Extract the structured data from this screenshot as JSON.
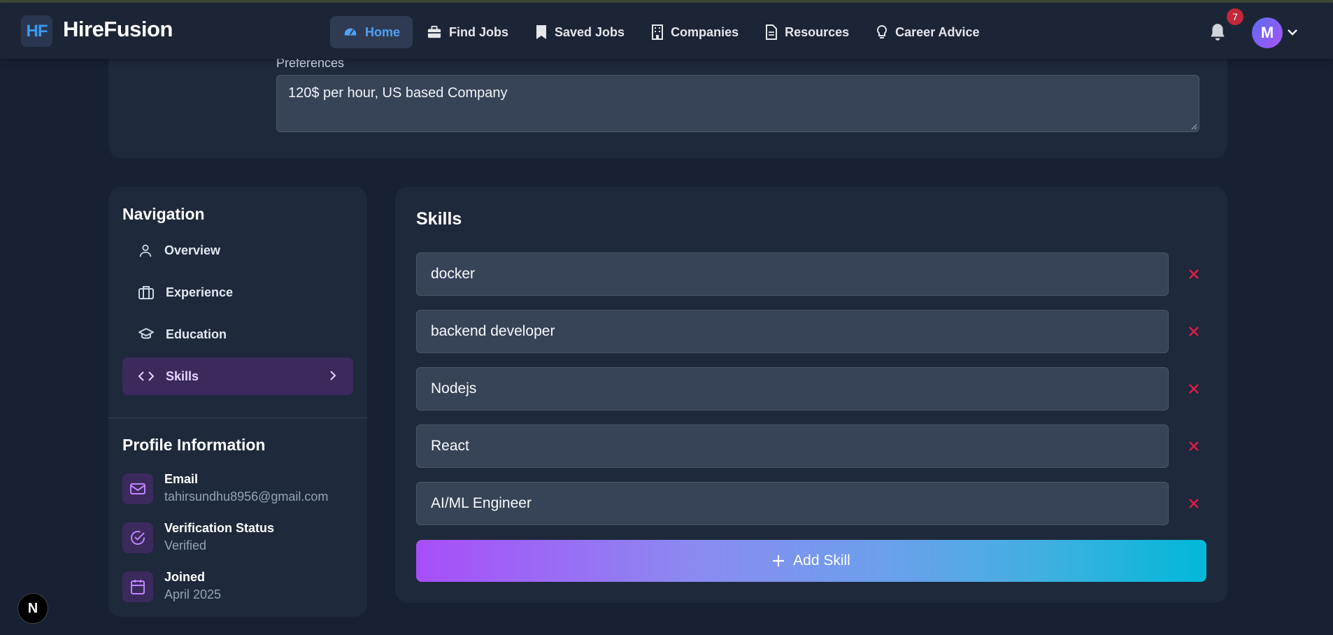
{
  "header": {
    "logo_mark": "HF",
    "app_name": "HireFusion",
    "nav": [
      {
        "label": "Home",
        "icon": "dashboard-icon",
        "active": true
      },
      {
        "label": "Find Jobs",
        "icon": "briefcase-icon"
      },
      {
        "label": "Saved Jobs",
        "icon": "bookmark-icon"
      },
      {
        "label": "Companies",
        "icon": "building-icon"
      },
      {
        "label": "Resources",
        "icon": "document-icon"
      },
      {
        "label": "Career Advice",
        "icon": "lightbulb-icon"
      }
    ],
    "notification_count": "7",
    "avatar_initial": "M"
  },
  "preferences": {
    "label": "Preferences",
    "value": "120$ per hour, US based Company"
  },
  "sidebar": {
    "title": "Navigation",
    "items": [
      {
        "label": "Overview",
        "icon": "user-icon"
      },
      {
        "label": "Experience",
        "icon": "briefcase-icon"
      },
      {
        "label": "Education",
        "icon": "graduation-cap-icon"
      },
      {
        "label": "Skills",
        "icon": "code-icon",
        "active": true
      }
    ]
  },
  "profile_info": {
    "title": "Profile Information",
    "email_label": "Email",
    "email_value": "tahirsundhu8956@gmail.com",
    "verification_label": "Verification Status",
    "verification_value": "Verified",
    "joined_label": "Joined",
    "joined_value": "April 2025"
  },
  "skills": {
    "title": "Skills",
    "items": [
      "docker",
      "backend developer",
      "Nodejs",
      "React",
      "AI/ML Engineer"
    ],
    "add_label": "Add Skill"
  },
  "dev_badge": "N",
  "colors": {
    "background": "#172133",
    "card": "#1e293b",
    "accent_blue": "#4ea2f5",
    "accent_purple": "#a855f7",
    "remove_red": "#e11d48"
  }
}
